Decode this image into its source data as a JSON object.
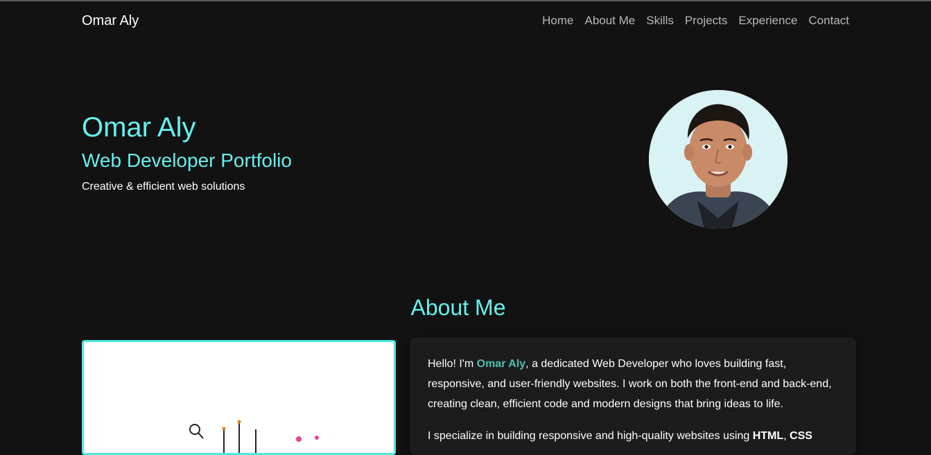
{
  "navbar": {
    "brand": "Omar Aly",
    "links": [
      "Home",
      "About Me",
      "Skills",
      "Projects",
      "Experience",
      "Contact"
    ]
  },
  "hero": {
    "name": "Omar Aly",
    "role": "Web Developer Portfolio",
    "tagline": "Creative & efficient web solutions",
    "avatar_icon": "profile-photo"
  },
  "about": {
    "title": "About Me",
    "intro_before": "Hello! I'm ",
    "intro_name": "Omar Aly",
    "intro_after": ", a dedicated Web Developer who loves building fast, responsive, and user-friendly websites. I work on both the front-end and back-end, creating clean, efficient code and modern designs that bring ideas to life.",
    "para2_before": "I specialize in building responsive and high-quality websites using ",
    "para2_html": "HTML",
    "para2_sep": ", ",
    "para2_css": "CSS",
    "image_icon": "developer-illustration"
  },
  "colors": {
    "background": "#121212",
    "accent": "#66f0ee",
    "card": "#1c1c1c",
    "highlight": "#4fbfae"
  }
}
